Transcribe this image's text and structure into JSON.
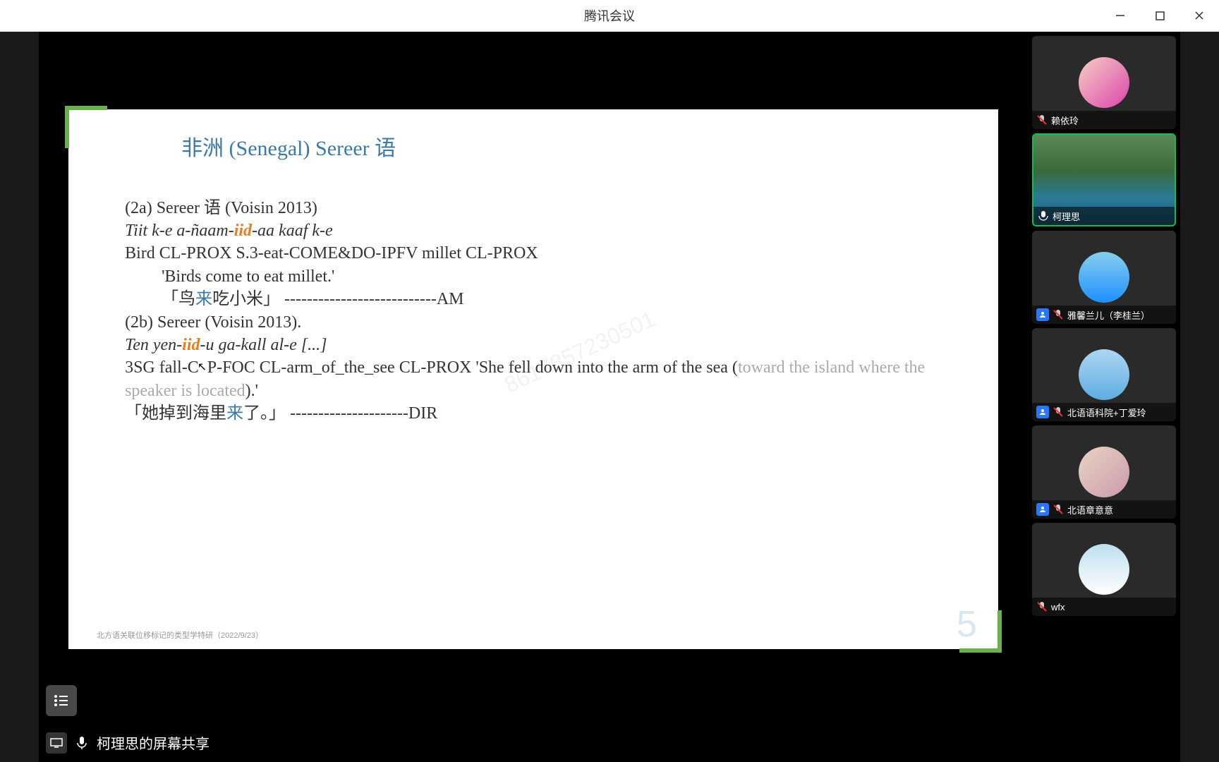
{
  "window": {
    "title": "腾讯会议"
  },
  "statusbar": {
    "text": "柯理思的屏幕共享"
  },
  "slide": {
    "title": "非洲 (Senegal) Sereer 语",
    "ex2a_label": "(2a) Sereer 语  (Voisin 2013)",
    "ex2a_line1_pre": "Tiit   k-e          a-ñaam-",
    "ex2a_line1_iid": "iid",
    "ex2a_line1_post": "-aa            kaaf   k-e",
    "ex2a_gloss": "Bird  CL-PROX   S.3-eat-COME&DO-IPFV millet CL-PROX",
    "ex2a_trans_en": "'Birds come to eat millet.'",
    "ex2a_trans_cn_pre": "「鸟",
    "ex2a_trans_cn_lai": "来",
    "ex2a_trans_cn_post": "吃小米」 ---------------------------AM",
    "ex2b_label": "(2b) Sereer (Voisin 2013).",
    "ex2b_line1_pre": "Ten   yen-",
    "ex2b_line1_iid": "iid",
    "ex2b_line1_post": "-u          ga-kall                   al-e [...]",
    "ex2b_gloss_pre": "3SG   fall-C",
    "ex2b_gloss_post": "P-FOC    CL-arm_of_the_see     CL-PROX 'She fell down into the arm of the sea (",
    "ex2b_gloss_faded": "toward the island where the speaker is located",
    "ex2b_gloss_end": ").'",
    "ex2b_trans_cn_pre": "「她掉到海里",
    "ex2b_trans_cn_lai": "来",
    "ex2b_trans_cn_post": "了。」   ---------------------DIR",
    "footer": "北方语关联位移标记的类型学特研（2022/9/23）",
    "pagenum": "5",
    "watermark": "8617857230501"
  },
  "participants": [
    {
      "name": "赖依玲",
      "muted": true,
      "has_badge": false,
      "active": false,
      "video": false,
      "avatar_class": "avatar-1"
    },
    {
      "name": "柯理思",
      "muted": false,
      "has_badge": false,
      "active": true,
      "video": true,
      "avatar_class": ""
    },
    {
      "name": "雅馨兰儿（李桂兰）",
      "muted": true,
      "has_badge": true,
      "active": false,
      "video": false,
      "avatar_class": "avatar-3"
    },
    {
      "name": "北语语科院+丁爱玲",
      "muted": true,
      "has_badge": true,
      "active": false,
      "video": false,
      "avatar_class": "avatar-4"
    },
    {
      "name": "北语章意意",
      "muted": true,
      "has_badge": true,
      "active": false,
      "video": false,
      "avatar_class": "avatar-5"
    },
    {
      "name": "wfx",
      "muted": true,
      "has_badge": false,
      "active": false,
      "video": false,
      "avatar_class": "avatar-6"
    }
  ]
}
